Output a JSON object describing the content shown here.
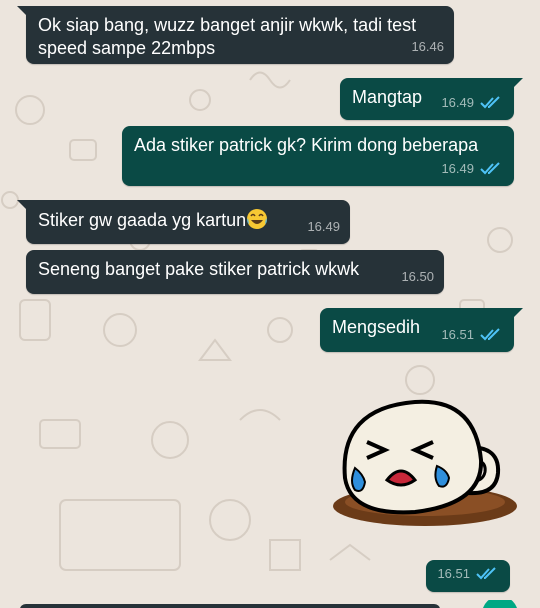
{
  "messages": [
    {
      "side": "in",
      "text": "Ok siap bang, wuzz banget anjir wkwk, tadi test speed sampe 22mbps",
      "time": "16.46"
    },
    {
      "side": "out",
      "text": "Mangtap",
      "time": "16.49",
      "status": "read"
    },
    {
      "side": "out",
      "text": "Ada stiker patrick gk? Kirim dong beberapa",
      "time": "16.49",
      "status": "read"
    },
    {
      "side": "in",
      "text": "Stiker gw gaada yg kartun",
      "emoji": "face-with-tears-of-joy-icon",
      "time": "16.49"
    },
    {
      "side": "in",
      "text": "Seneng banget pake stiker patrick wkwk",
      "time": "16.50"
    },
    {
      "side": "out",
      "text": "Mengsedih",
      "time": "16.51",
      "status": "read"
    }
  ],
  "sticker": {
    "name": "crying-cup-sticker",
    "time": "16.51",
    "status": "read"
  },
  "colors": {
    "incoming_bubble": "#263238",
    "outgoing_bubble": "#0a4a45",
    "read_ticks": "#4fc3f7",
    "wallpaper": "#ece5dd"
  }
}
